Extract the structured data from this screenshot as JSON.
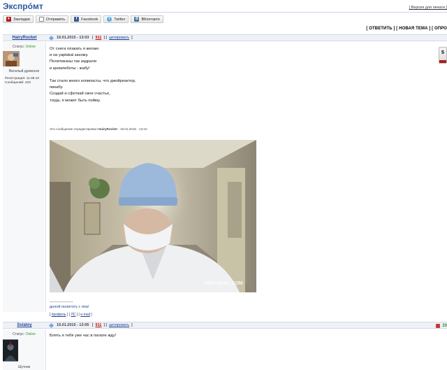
{
  "topic": {
    "title": "Экспрóмт",
    "print_link": "[ Версия для печати ]"
  },
  "share": [
    {
      "icon": "bookmark-icon",
      "label": "Закладки"
    },
    {
      "icon": "mail-icon",
      "label": "Отправить"
    },
    {
      "icon": "facebook-icon",
      "label": "Facebook"
    },
    {
      "icon": "twitter-icon",
      "label": "Twitter"
    },
    {
      "icon": "vkontakte-icon",
      "label": "ВКонтакте"
    }
  ],
  "actions": {
    "reply": "[ ОТВЕТИТЬ ]",
    "new_topic": "[ НОВАЯ ТЕМА ]",
    "poll": "[ ОПРО"
  },
  "posts": [
    {
      "author": "HairyRocket",
      "date": "19.01.2015 - 13:03",
      "quote_num": "911",
      "quote_label": "цитировать",
      "status_label": "Статус:",
      "status": "Online",
      "rank": "Веселый дровосек",
      "registered": "Регистрация: 11.08.10",
      "messages": "Сообщений: 433",
      "body": [
        "От снега плакать я желаю",
        "и на yaplakal захожу.",
        "Политиканы так задрали",
        "и кремлеботы - жабу!",
        "",
        "Так стало много копипасты, что джойреактор,",
        "пикабу.",
        "Создай и сфоткай свое счастье,",
        "тогда, я может быть пойму."
      ],
      "edited_prefix": "Это сообщение отредактировал",
      "edited_author": "HairyRocket",
      "edited_date": " - 19.01.2015 - 13:10",
      "watermark": "YAPLAKAL.COM",
      "sig_rule": "--------------------",
      "signature": "долой политоту с япа!",
      "links": [
        "профиль",
        "ЛС",
        "e-mail"
      ],
      "rating": "5"
    },
    {
      "author": "Sviatoy",
      "date": "19.01.2015 - 13:05",
      "quote_num": "911",
      "quote_label": "цитировать",
      "status_label": "Статус:",
      "status": "Online",
      "rank": "Шутник",
      "body": [
        "Блять я тебя уже час в палате жду!"
      ],
      "post_number": "20"
    }
  ],
  "colors": {
    "title": "#2a5a9e",
    "link": "#1c3f95",
    "quote": "#cc0000",
    "online": "#2b9a2b",
    "rating_bar": "#b01c1c"
  }
}
